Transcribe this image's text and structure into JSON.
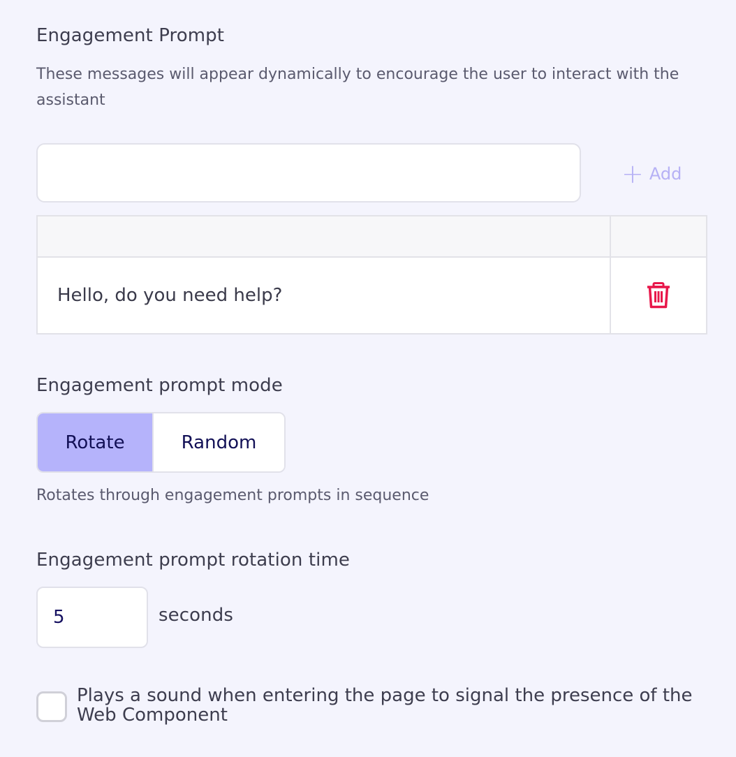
{
  "engagement_prompt": {
    "title": "Engagement Prompt",
    "description": "These messages will appear dynamically to encourage the user to interact with the assistant",
    "input_value": "",
    "add_label": "Add",
    "add_icon": "plus-icon",
    "table": {
      "header": [
        "",
        ""
      ],
      "rows": [
        {
          "text": "Hello, do you need help?",
          "action_icon": "trash-icon"
        }
      ]
    }
  },
  "mode": {
    "title": "Engagement prompt mode",
    "options": [
      "Rotate",
      "Random"
    ],
    "selected": "Rotate",
    "help_text": "Rotates through engagement prompts in sequence"
  },
  "rotation": {
    "title": "Engagement prompt rotation time",
    "value": "5",
    "unit": "seconds"
  },
  "sound": {
    "checked": false,
    "label": "Plays a sound when entering the page to signal the presence of the Web Component"
  },
  "colors": {
    "background": "#f4f4fd",
    "accent": "#b5b3fb",
    "add_text": "#b6b1f5",
    "danger": "#e8174a"
  }
}
